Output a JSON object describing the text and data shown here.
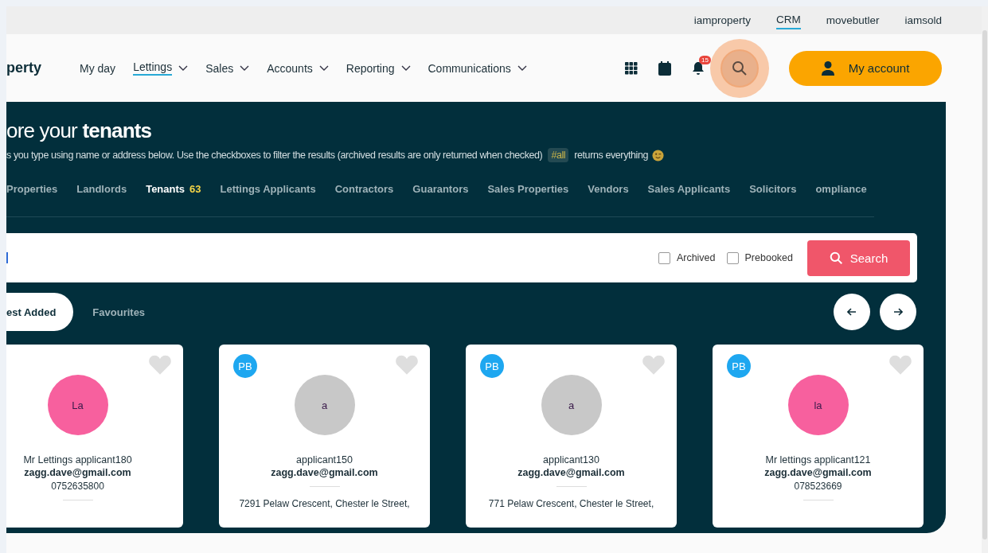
{
  "top_links": [
    {
      "label": "iamproperty",
      "selected": false
    },
    {
      "label": "CRM",
      "selected": true
    },
    {
      "label": "movebutler",
      "selected": false
    },
    {
      "label": "iamsold",
      "selected": false
    }
  ],
  "logo": "perty",
  "nav": [
    {
      "label": "My day",
      "selected": false,
      "has_menu": false
    },
    {
      "label": "Lettings",
      "selected": true,
      "has_menu": true
    },
    {
      "label": "Sales",
      "selected": false,
      "has_menu": true
    },
    {
      "label": "Accounts",
      "selected": false,
      "has_menu": true
    },
    {
      "label": "Reporting",
      "selected": false,
      "has_menu": true
    },
    {
      "label": "Communications",
      "selected": false,
      "has_menu": true
    }
  ],
  "notification_count": "15",
  "search_highlighted": true,
  "account_button": "My account",
  "hero": {
    "title": "ore your **tenants**",
    "subtitle": "s you type using name or address below. Use the checkboxes to filter the results (archived results are only returned when checked)",
    "tag": "#all",
    "subtitle_end": "returns everything"
  },
  "categories": [
    {
      "label": "Properties",
      "selected": false
    },
    {
      "label": "Landlords",
      "selected": false
    },
    {
      "label": "Tenants",
      "selected": true,
      "count": "63"
    },
    {
      "label": "Lettings Applicants",
      "selected": false
    },
    {
      "label": "Contractors",
      "selected": false
    },
    {
      "label": "Guarantors",
      "selected": false
    },
    {
      "label": "Sales Properties",
      "selected": false
    },
    {
      "label": "Vendors",
      "selected": false
    },
    {
      "label": "Sales Applicants",
      "selected": false
    },
    {
      "label": "Solicitors",
      "selected": false
    },
    {
      "label": "ompliance",
      "selected": false
    }
  ],
  "search": {
    "filters": [
      {
        "label": "Archived",
        "checked": false
      },
      {
        "label": "Prebooked",
        "checked": false
      }
    ],
    "button": "Search"
  },
  "sort_tabs": [
    {
      "label": "est Added",
      "selected": true
    },
    {
      "label": "Favourites",
      "selected": false
    }
  ],
  "cards": [
    {
      "prebooked": false,
      "initials": "La",
      "color": "#f7609e",
      "name": "Mr Lettings applicant180",
      "email": "zagg.dave@gmail.com",
      "phone": "0752635800"
    },
    {
      "prebooked": true,
      "badge": "PB",
      "initials": "a",
      "color": "#c8c8c8",
      "name": "applicant150",
      "email": "zagg.dave@gmail.com",
      "address": "7291 Pelaw Crescent, Chester le Street,"
    },
    {
      "prebooked": true,
      "badge": "PB",
      "initials": "a",
      "color": "#c8c8c8",
      "name": "applicant130",
      "email": "zagg.dave@gmail.com",
      "address": "771 Pelaw Crescent, Chester le Street,"
    },
    {
      "prebooked": true,
      "badge": "PB",
      "initials": "la",
      "color": "#f7609e",
      "name": "Mr lettings applicant121",
      "email": "zagg.dave@gmail.com",
      "phone": "078523669"
    }
  ]
}
